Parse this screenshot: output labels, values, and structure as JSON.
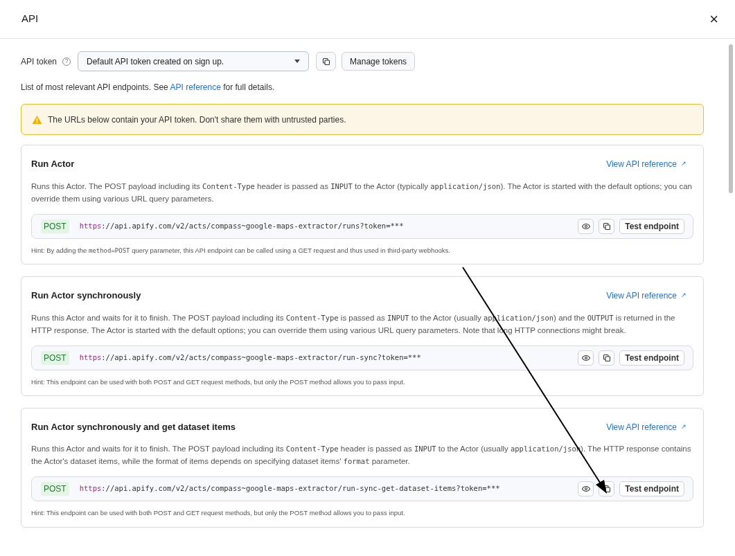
{
  "dialog": {
    "title": "API",
    "close": "×"
  },
  "token": {
    "label": "API token",
    "help": "?",
    "value": "Default API token created on sign up.",
    "manage": "Manage tokens"
  },
  "intro": {
    "before": "List of most relevant API endpoints. See ",
    "link": "API reference",
    "after": " for full details."
  },
  "warning": "The URLs below contain your API token. Don't share them with untrusted parties.",
  "endpoints": [
    {
      "title": "Run Actor",
      "reference": "View API reference",
      "reference_icon": "↗",
      "description": [
        {
          "text": "Runs this Actor. The POST payload including its ",
          "code": false
        },
        {
          "text": "Content-Type",
          "code": true
        },
        {
          "text": " header is passed as ",
          "code": false
        },
        {
          "text": "INPUT",
          "code": true
        },
        {
          "text": " to the Actor (typically ",
          "code": false
        },
        {
          "text": "application/json",
          "code": true
        },
        {
          "text": "). The Actor is started with the default options; you can override them using various URL query parameters.",
          "code": false
        }
      ],
      "method": "POST",
      "url": [
        {
          "text": "https",
          "kind": "scheme"
        },
        {
          "text": "://api.apify.com/v2/acts/compass~google-maps-extractor/runs?token=***",
          "kind": "path"
        }
      ],
      "test": "Test endpoint",
      "hint": [
        {
          "text": "Hint: By adding the ",
          "code": false
        },
        {
          "text": "method=POST",
          "code": true
        },
        {
          "text": " query parameter, this API endpoint can be called using a GET request and thus used in third-party webhooks.",
          "code": false
        }
      ]
    },
    {
      "title": "Run Actor synchronously",
      "reference": "View API reference",
      "reference_icon": "↗",
      "description": [
        {
          "text": "Runs this Actor and waits for it to finish. The POST payload including its ",
          "code": false
        },
        {
          "text": "Content-Type",
          "code": true
        },
        {
          "text": " is passed as ",
          "code": false
        },
        {
          "text": "INPUT",
          "code": true
        },
        {
          "text": " to the Actor (usually ",
          "code": false
        },
        {
          "text": "application/json",
          "code": true
        },
        {
          "text": ") and the ",
          "code": false
        },
        {
          "text": "OUTPUT",
          "code": true
        },
        {
          "text": " is returned in the HTTP response. The Actor is started with the default options; you can override them using various URL query parameters. Note that long HTTP connections might break.",
          "code": false
        }
      ],
      "method": "POST",
      "url": [
        {
          "text": "https",
          "kind": "scheme"
        },
        {
          "text": "://api.apify.com/v2/acts/compass~google-maps-extractor/run-sync?token=***",
          "kind": "path"
        }
      ],
      "test": "Test endpoint",
      "hint": [
        {
          "text": "Hint: This endpoint can be used with both POST and GET request methods, but only the POST method allows you to pass input.",
          "code": false
        }
      ]
    },
    {
      "title": "Run Actor synchronously and get dataset items",
      "reference": "View API reference",
      "reference_icon": "↗",
      "description": [
        {
          "text": "Runs this Actor and waits for it to finish. The POST payload including its ",
          "code": false
        },
        {
          "text": "Content-Type",
          "code": true
        },
        {
          "text": " header is passed as ",
          "code": false
        },
        {
          "text": "INPUT",
          "code": true
        },
        {
          "text": " to the Actor (usually ",
          "code": false
        },
        {
          "text": "application/json",
          "code": true
        },
        {
          "text": "). The HTTP response contains the Actor's dataset items, while the format of items depends on specifying dataset items' ",
          "code": false
        },
        {
          "text": "format",
          "code": true
        },
        {
          "text": " parameter.",
          "code": false
        }
      ],
      "method": "POST",
      "url": [
        {
          "text": "https",
          "kind": "scheme"
        },
        {
          "text": "://api.apify.com/v2/acts/compass~google-maps-extractor/run-sync-get-dataset-items?token=***",
          "kind": "path"
        }
      ],
      "test": "Test endpoint",
      "hint": [
        {
          "text": "Hint: This endpoint can be used with both POST and GET request methods, but only the POST method allows you to pass input.",
          "code": false
        }
      ]
    }
  ]
}
